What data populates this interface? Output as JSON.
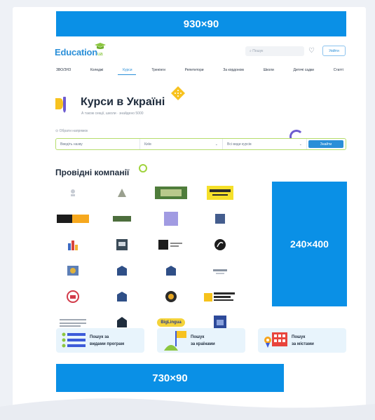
{
  "banners": {
    "top": "930×90",
    "side": "240×400",
    "bottom": "730×90"
  },
  "header": {
    "logo_main": "Education",
    "logo_suffix": "ua",
    "search_placeholder": "Пошук",
    "login_label": "Увійти"
  },
  "nav": {
    "items": [
      "ЗВО/ЗНЗ",
      "Коледжі",
      "Курси",
      "Тренінги",
      "Репетитори",
      "За кордоном",
      "Школи",
      "Дитячі садки",
      "Статті"
    ],
    "active_index": 2
  },
  "hero": {
    "title": "Курси в Україні",
    "subtitle": "А також секції, школи · знайдено 5000"
  },
  "filter": {
    "label": "Обрати напрямок",
    "course_placeholder": "Введіть назву",
    "city_value": "Київ",
    "type_value": "Всі види курсів",
    "search_button": "Знайти"
  },
  "companies": {
    "title": "Провідні компанії",
    "logos": [
      "Company logo",
      "Company logo",
      "Company logo",
      "Company logo",
      "Company logo",
      "Company logo",
      "Company logo",
      "Company logo",
      "Company logo",
      "Company logo",
      "Company logo",
      "Company logo",
      "Company logo",
      "Company logo",
      "Company logo",
      "Company logo",
      "Company logo",
      "Company logo",
      "Company logo",
      "Company logo",
      "Company logo",
      "Company logo",
      "BigLingua",
      "Company logo"
    ]
  },
  "categories": [
    {
      "line1": "Пошук за",
      "line2": "видами програм"
    },
    {
      "line1": "Пошук",
      "line2": "за країнами"
    },
    {
      "line1": "Пошук",
      "line2": "за містами"
    }
  ]
}
